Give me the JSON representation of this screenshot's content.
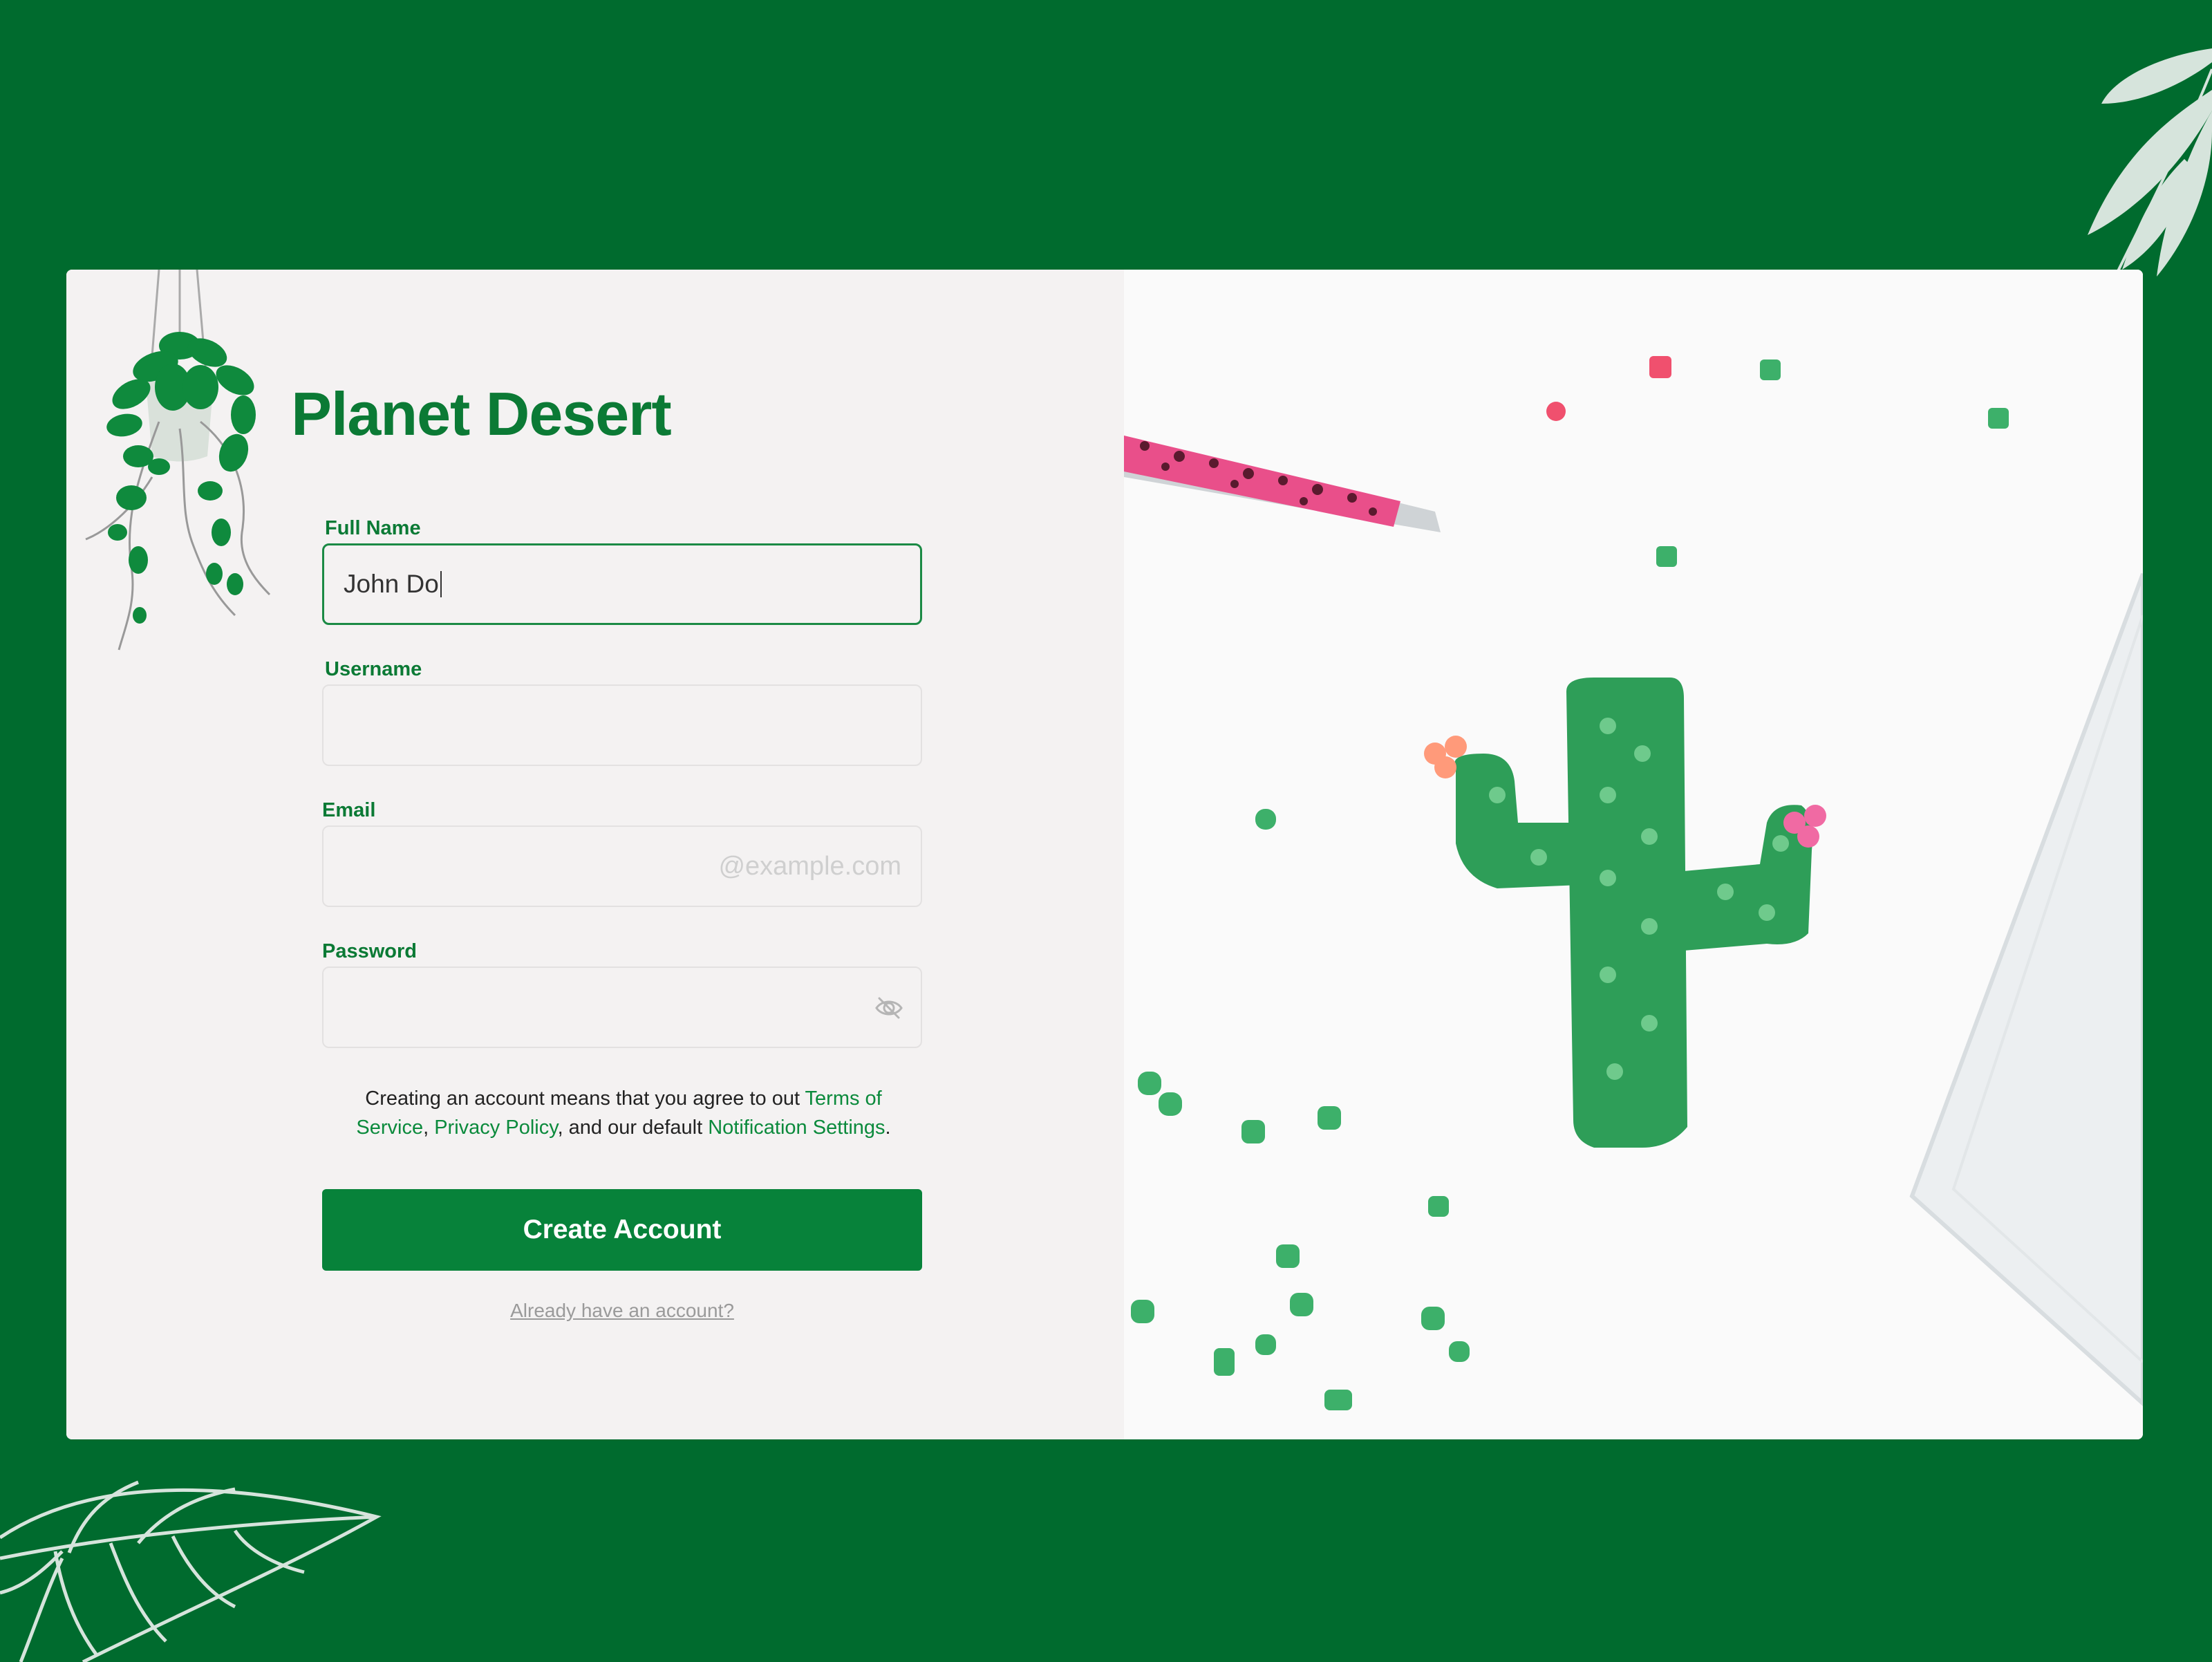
{
  "brand": {
    "title": "Planet Desert",
    "primary_color": "#0b7a35",
    "background_color": "#006b2e"
  },
  "form": {
    "full_name": {
      "label": "Full Name",
      "value": "John Do"
    },
    "username": {
      "label": "Username",
      "value": ""
    },
    "email": {
      "label": "Email",
      "value": "",
      "placeholder": "@example.com"
    },
    "password": {
      "label": "Password",
      "value": "",
      "toggle_icon": "eye-off-icon"
    }
  },
  "terms": {
    "prefix": "Creating an account means that you agree to out ",
    "terms_link": "Terms of Service",
    "separator": ", ",
    "privacy_link": "Privacy Policy",
    "middle": ", and our default ",
    "notification_link": "Notification Settings",
    "suffix": "."
  },
  "actions": {
    "create_account": "Create Account",
    "already_have_account": "Already have an account?"
  }
}
